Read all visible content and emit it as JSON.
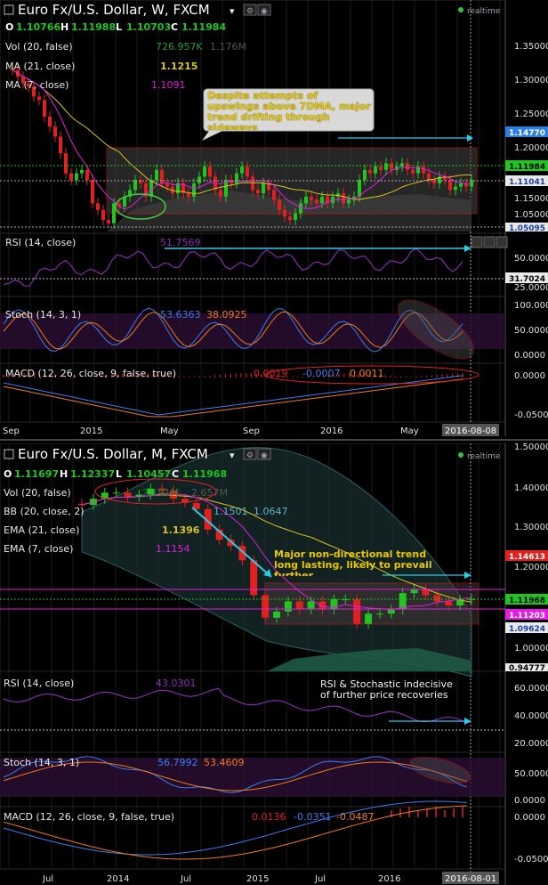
{
  "colors": {
    "up": "#21c421",
    "down": "#e0211f",
    "ma21": "#d8c421",
    "ma7": "#e11ee1",
    "rsi": "#9b30c9",
    "stochK": "#3b7cf0",
    "stochD": "#f07a1a",
    "cyan": "#2fc9e8",
    "grid": "#1a1a1a"
  },
  "realtime": "realtime",
  "weekly": {
    "title": "Euro Fx/U.S. Dollar, W, FXCM",
    "ohlc": {
      "o_label": "O",
      "o": "1.10766",
      "h_label": "H",
      "h": "1.11988",
      "l_label": "L",
      "l": "1.10703",
      "c_label": "C",
      "c": "1.11984"
    },
    "vol_label": "Vol (20, false)",
    "vol_vals": [
      "726.957K",
      "1.176M"
    ],
    "ma21_label": "MA (21, close)",
    "ma21_value": "1.1215",
    "ma7_label": "MA (7, close)",
    "ma7_value": "1.1091",
    "annotation": "Despite attempts of upswings above 7DMA, major trend drifting through sideways",
    "price_ticks": [
      "1.35000",
      "1.30000",
      "1.25000",
      "1.20000",
      "1.15000",
      "1.05000"
    ],
    "price_tags": [
      "1.14770",
      "1.11984",
      "1.11041",
      "1.05095"
    ],
    "rsi_label": "RSI (14, close)",
    "rsi_value": "51.7569",
    "rsi_ticks": [
      "50.0000",
      "25.0000"
    ],
    "rsi_tag": "31.7024",
    "stoch_label": "Stoch (14, 3, 1)",
    "stoch_k": "53.6363",
    "stoch_d": "38.0925",
    "stoch_ticks": [
      "100.0000",
      "50.0000",
      "0.0000"
    ],
    "macd_label": "MACD (12, 26, close, 9, false, true)",
    "macd_vals": [
      "0.0019",
      "-0.0007",
      "0.0011"
    ],
    "macd_ticks": [
      "0.0000",
      "-0.0500"
    ],
    "time_ticks": [
      "Sep",
      "2015",
      "May",
      "Sep",
      "2016",
      "May"
    ],
    "date_tag": "2016-08-08"
  },
  "monthly": {
    "title": "Euro Fx/U.S. Dollar, M, FXCM",
    "ohlc": {
      "o_label": "O",
      "o": "1.11697",
      "h_label": "H",
      "h": "1.12337",
      "l_label": "L",
      "l": "1.10457",
      "c_label": "C",
      "c": "1.11968"
    },
    "vol_label": "Vol (20, false)",
    "vol_vals": [
      "2.191M",
      "2.657M"
    ],
    "bb_label": "BB (20, close, 2)",
    "bb_vals": [
      "1.1501",
      "1.0647"
    ],
    "ema21_label": "EMA (21, close)",
    "ema21_value": "1.1396",
    "ema7_label": "EMA (7, close)",
    "ema7_value": "1.1154",
    "annotation": "Major non-directional trend long lasting, likely to prevail further",
    "price_ticks": [
      "1.50000",
      "1.40000",
      "1.30000",
      "1.20000",
      "1.00000"
    ],
    "price_tags": [
      "1.14613",
      "1.11968",
      "1.11203",
      "1.09624",
      "0.94777"
    ],
    "rsi_label": "RSI (14, close)",
    "rsi_value": "43.0301",
    "rsi_note": "RSI & Stochastic indecisive of further price recoveries",
    "rsi_ticks": [
      "60.0000",
      "40.0000",
      "20.0000"
    ],
    "stoch_label": "Stoch (14, 3, 1)",
    "stoch_k": "56.7992",
    "stoch_d": "53.4609",
    "stoch_ticks": [
      "50.0000",
      "0.0000"
    ],
    "macd_label": "MACD (12, 26, close, 9, false, true)",
    "macd_vals": [
      "0.0136",
      "-0.0351",
      "-0.0487"
    ],
    "macd_ticks": [
      "0.0000",
      "-0.0500"
    ],
    "time_ticks": [
      "Jul",
      "2014",
      "Jul",
      "2015",
      "Jul",
      "2016"
    ],
    "date_tag": "2016-08-01"
  },
  "chart_data": [
    {
      "type": "candlestick",
      "title": "Euro Fx/U.S. Dollar, W, FXCM",
      "ylim": [
        1.04,
        1.39
      ],
      "x": [
        "Sep",
        "2015",
        "May",
        "Sep",
        "2016",
        "May"
      ],
      "close": [
        1.285,
        1.275,
        1.265,
        1.26,
        1.245,
        1.24,
        1.215,
        1.2,
        1.185,
        1.16,
        1.13,
        1.12,
        1.13,
        1.135,
        1.12,
        1.085,
        1.075,
        1.06,
        1.055,
        1.085,
        1.08,
        1.095,
        1.105,
        1.12,
        1.115,
        1.095,
        1.12,
        1.135,
        1.115,
        1.11,
        1.1,
        1.115,
        1.1,
        1.095,
        1.115,
        1.125,
        1.14,
        1.125,
        1.105,
        1.095,
        1.12,
        1.115,
        1.13,
        1.14,
        1.125,
        1.105,
        1.1,
        1.115,
        1.105,
        1.09,
        1.075,
        1.065,
        1.06,
        1.07,
        1.085,
        1.095,
        1.09,
        1.085,
        1.095,
        1.085,
        1.095,
        1.1,
        1.085,
        1.09,
        1.095,
        1.12,
        1.135,
        1.13,
        1.14,
        1.135,
        1.145,
        1.135,
        1.14,
        1.145,
        1.135,
        1.13,
        1.14,
        1.13,
        1.12,
        1.115,
        1.125,
        1.12,
        1.105,
        1.11,
        1.115,
        1.11,
        1.12
      ],
      "annotations": [
        "Despite attempts of upswings above 7DMA, major trend drifting through sideways"
      ]
    },
    {
      "type": "candlestick",
      "title": "Euro Fx/U.S. Dollar, M, FXCM",
      "ylim": [
        0.94,
        1.5
      ],
      "x": [
        "Jul",
        "2014",
        "Jul",
        "2015",
        "Jul",
        "2016"
      ],
      "close": [
        1.35,
        1.365,
        1.38,
        1.38,
        1.37,
        1.375,
        1.39,
        1.385,
        1.365,
        1.355,
        1.34,
        1.29,
        1.265,
        1.25,
        1.215,
        1.13,
        1.075,
        1.09,
        1.115,
        1.095,
        1.115,
        1.095,
        1.12,
        1.12,
        1.06,
        1.085,
        1.085,
        1.095,
        1.135,
        1.145,
        1.13,
        1.115,
        1.105,
        1.118,
        1.12
      ]
    }
  ]
}
